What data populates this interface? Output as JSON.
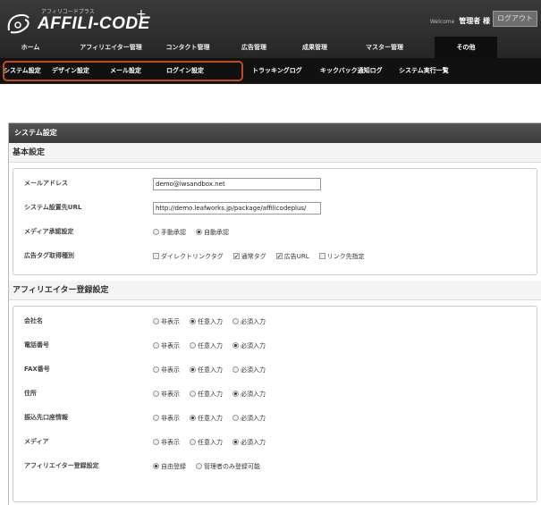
{
  "header": {
    "logo_small": "アフィリコードプラス",
    "logo_main": "AFFILI-CODE",
    "logo_plus": "+",
    "welcome_label": "Welcome",
    "user_name": "管理者 様",
    "logout_label": "ログアウト"
  },
  "main_nav": [
    {
      "label": "ホーム",
      "active": false
    },
    {
      "label": "アフィリエイター管理",
      "active": false
    },
    {
      "label": "コンタクト管理",
      "active": false
    },
    {
      "label": "広告管理",
      "active": false
    },
    {
      "label": "成果管理",
      "active": false
    },
    {
      "label": "マスター管理",
      "active": false
    },
    {
      "label": "その他",
      "active": true
    }
  ],
  "sub_nav": [
    {
      "label": "システム設定"
    },
    {
      "label": "デザイン設定"
    },
    {
      "label": "メール設定"
    },
    {
      "label": "ログイン設定"
    },
    {
      "label": "トラッキングログ"
    },
    {
      "label": "キックバック通知ログ"
    },
    {
      "label": "システム実行一覧"
    }
  ],
  "panel": {
    "title": "システム設定",
    "basic": {
      "heading": "基本設定",
      "email_label": "メールアドレス",
      "email_value": "demo@lwsandbox.net",
      "url_label": "システム設置先URL",
      "url_value": "http://demo.leafworks.jp/package/affilicodeplus/",
      "media_label": "メディア承認設定",
      "media_opt1": "手動承認",
      "media_opt2": "自動承認",
      "tag_label": "広告タグ取得種別",
      "tag_opt1": "ダイレクトリンクタグ",
      "tag_opt2": "通常タグ",
      "tag_opt3": "広告URL",
      "tag_opt4": "リンク先指定"
    },
    "affiliate": {
      "heading": "アフィリエイター登録設定",
      "rows": [
        {
          "label": "会社名",
          "selected": 1
        },
        {
          "label": "電話番号",
          "selected": 2
        },
        {
          "label": "FAX番号",
          "selected": 1
        },
        {
          "label": "住所",
          "selected": 2
        },
        {
          "label": "振込先口座情報",
          "selected": 1
        },
        {
          "label": "メディア",
          "selected": 2
        }
      ],
      "opt_hidden": "非表示",
      "opt_optional": "任意入力",
      "opt_required": "必須入力",
      "reg_label": "アフィリエイター登録設定",
      "reg_opt1": "自由登録",
      "reg_opt2": "管理者のみ登録可能"
    }
  }
}
